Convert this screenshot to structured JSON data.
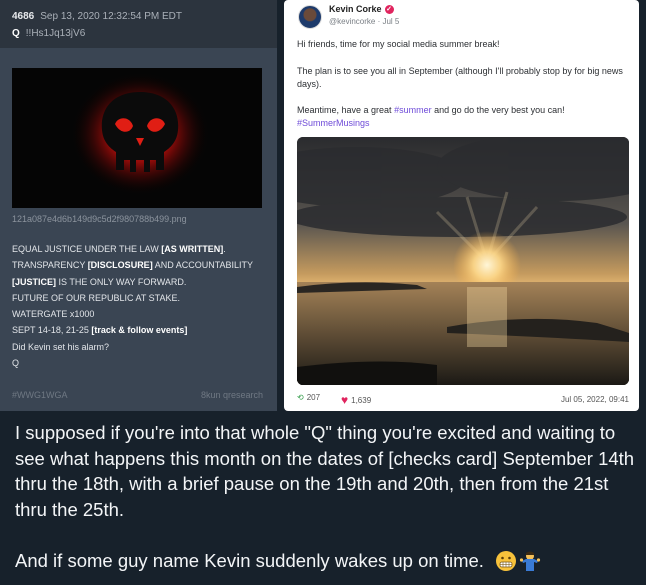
{
  "qpost": {
    "number": "4686",
    "date": "Sep 13, 2020 12:32:54 PM EDT",
    "author": "Q",
    "tripcode": "!!Hs1Jq13jV6",
    "filename": "121a087e4d6b149d9c5d2f980788b499.png",
    "lines": [
      {
        "pre": "EQUAL JUSTICE UNDER THE LAW ",
        "bold": "[AS WRITTEN]",
        "post": "."
      },
      {
        "pre": "TRANSPARENCY ",
        "bold": "[DISCLOSURE]",
        "post": " AND ACCOUNTABILITY"
      },
      {
        "pre": "",
        "bold": "[JUSTICE]",
        "post": " IS THE ONLY WAY FORWARD."
      },
      {
        "pre": "FUTURE OF OUR REPUBLIC AT STAKE.",
        "bold": "",
        "post": ""
      },
      {
        "pre": "WATERGATE x1000",
        "bold": "",
        "post": ""
      },
      {
        "pre": "SEPT 14-18, 21-25 ",
        "bold": "[track & follow events]",
        "post": ""
      },
      {
        "pre": "Did Kevin set his alarm?",
        "bold": "",
        "post": ""
      },
      {
        "pre": "Q",
        "bold": "",
        "post": ""
      }
    ],
    "footer_tag": "#WWG1WGA",
    "footer_source": "8kun qresearch"
  },
  "tweet": {
    "name": "Kevin Corke",
    "handle": "@kevincorke · Jul 5",
    "p1": "Hi friends, time for my social media summer break!",
    "p2": "The plan is to see you all in September (although I'll probably stop by for big news days).",
    "p3_pre": "Meantime, have a great ",
    "p3_tag1": "#summer",
    "p3_post": " and go do the very best you can!",
    "p3_tag2": "#SummerMusings",
    "retweets": "207",
    "likes": "1,639",
    "date": "Jul 05, 2022, 09:41"
  },
  "caption": {
    "text": "I supposed if you're into that whole \"Q\" thing you're excited and waiting to see what happens this month on the dates of [checks card] September 14th thru the 18th, with a brief pause on the 19th and 20th, then from the 21st thru the 25th.",
    "text2": "And if some guy name Kevin suddenly wakes up on time."
  }
}
